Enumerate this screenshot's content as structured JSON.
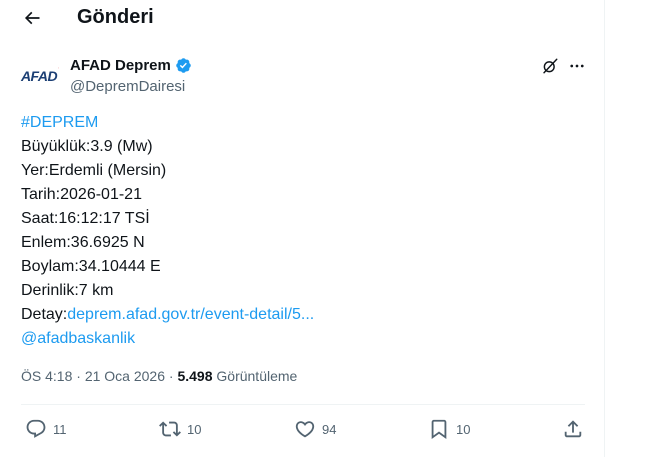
{
  "header": {
    "title": "Gönderi",
    "back_icon": "arrow-left-icon"
  },
  "author": {
    "avatar_logo_text": "AFAD",
    "name": "AFAD Deprem",
    "handle": "@DepremDairesi",
    "verified": true,
    "verified_color": "#1d9bf0"
  },
  "tweet": {
    "hashtag": "#DEPREM",
    "magnitude": "Büyüklük:3.9 (Mw)",
    "location": "Yer:Erdemli (Mersin)",
    "date": "Tarih:2026-01-21",
    "time": "Saat:16:12:17 TSİ",
    "latitude": "Enlem:36.6925 N",
    "longitude": "Boylam:34.10444 E",
    "depth": "Derinlik:7 km",
    "detail_label": "Detay:",
    "detail_link": "deprem.afad.gov.tr/event-detail/5...",
    "mention": "@afadbaskanlik"
  },
  "meta": {
    "time": "ÖS 4:18",
    "separator": " · ",
    "date": "21 Oca 2026",
    "separator2": " · ",
    "views": "5.498",
    "views_label": " Görüntüleme"
  },
  "actions": {
    "replies": "11",
    "reposts": "10",
    "likes": "94",
    "bookmarks": "10"
  },
  "colors": {
    "accent": "#1d9bf0",
    "text": "#0f1419",
    "secondary": "#536471",
    "border": "#eff3f4",
    "logo_blue": "#1c3f74",
    "logo_red": "#d7262d"
  }
}
